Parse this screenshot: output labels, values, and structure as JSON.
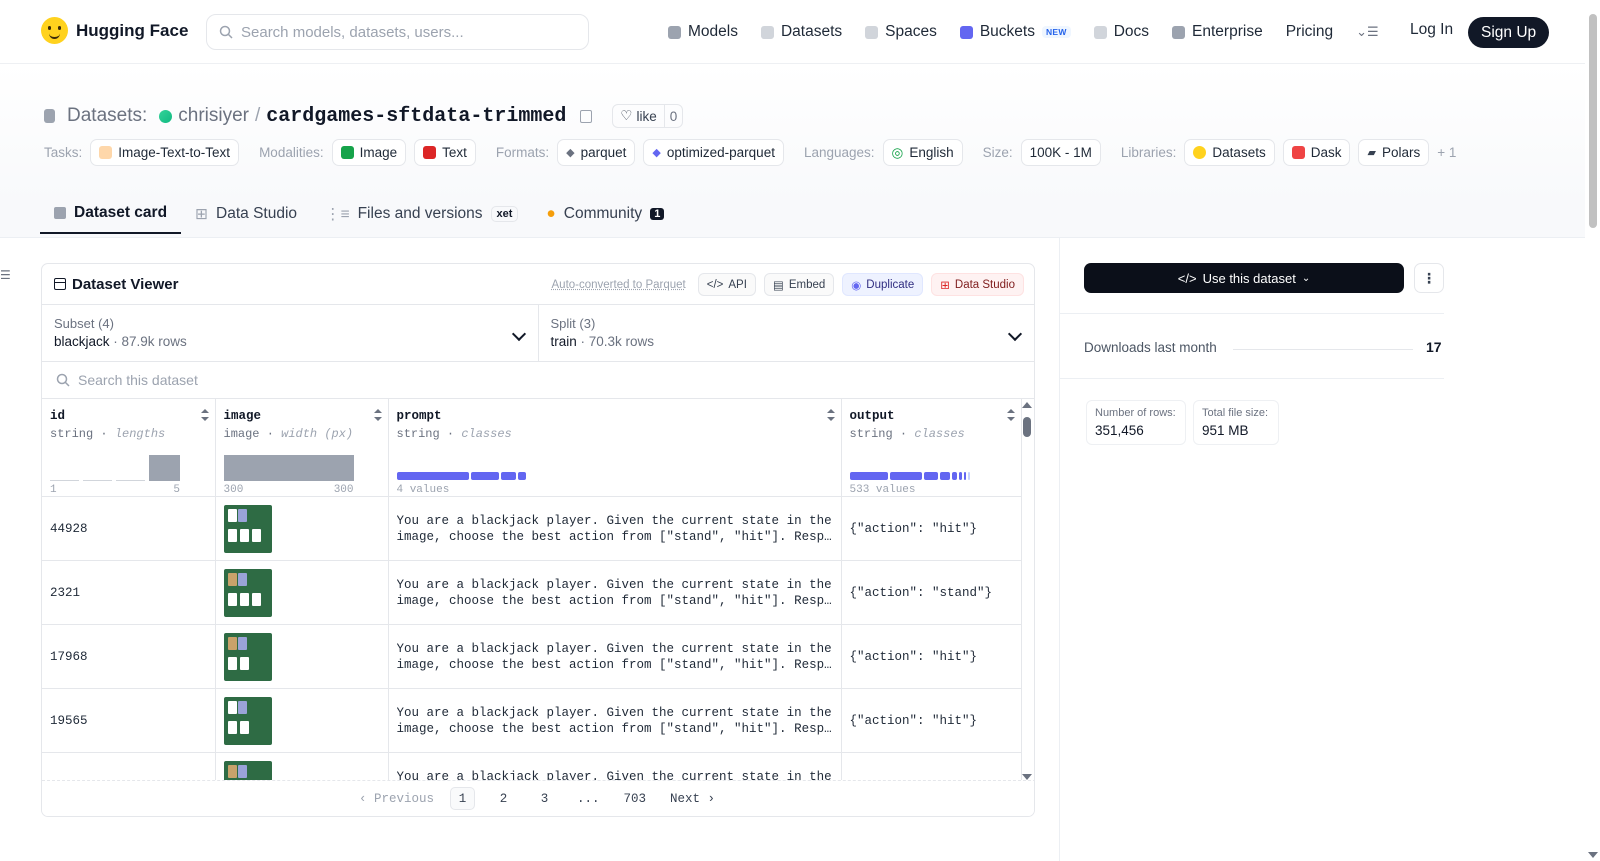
{
  "header": {
    "brand": "Hugging Face",
    "search_placeholder": "Search models, datasets, users...",
    "nav": [
      {
        "label": "Models",
        "icon": "models-icon",
        "color": "#9ca3af"
      },
      {
        "label": "Datasets",
        "icon": "datasets-icon",
        "color": "#d1d5db"
      },
      {
        "label": "Spaces",
        "icon": "spaces-icon",
        "color": "#d1d5db"
      },
      {
        "label": "Buckets",
        "icon": "buckets-icon",
        "color": "#6366f1",
        "badge": "NEW"
      },
      {
        "label": "Docs",
        "icon": "docs-icon",
        "color": "#d1d5db"
      },
      {
        "label": "Enterprise",
        "icon": "enterprise-icon",
        "color": "#9ca3af"
      },
      {
        "label": "Pricing"
      }
    ],
    "login": "Log In",
    "signup": "Sign Up"
  },
  "dataset": {
    "section_label": "Datasets:",
    "owner": "chrisiyer",
    "name": "cardgames-sftdata-trimmed",
    "like_label": "like",
    "like_count": "0"
  },
  "tags": {
    "tasks_label": "Tasks:",
    "tasks": [
      "Image-Text-to-Text"
    ],
    "modalities_label": "Modalities:",
    "modalities": [
      "Image",
      "Text"
    ],
    "formats_label": "Formats:",
    "formats": [
      "parquet",
      "optimized-parquet"
    ],
    "languages_label": "Languages:",
    "languages": [
      "English"
    ],
    "size_label": "Size:",
    "size": "100K - 1M",
    "libraries_label": "Libraries:",
    "libraries": [
      "Datasets",
      "Dask",
      "Polars"
    ],
    "more": "+ 1"
  },
  "tabs": {
    "card": "Dataset card",
    "studio": "Data Studio",
    "files": "Files and versions",
    "xet": "xet",
    "community": "Community",
    "community_count": "1"
  },
  "viewer": {
    "title": "Dataset Viewer",
    "auto_converted": "Auto-converted to Parquet",
    "api": "API",
    "embed": "Embed",
    "duplicate": "Duplicate",
    "data_studio": "Data Studio",
    "subset_label": "Subset (4)",
    "subset_value": "blackjack",
    "subset_rows": "87.9k rows",
    "split_label": "Split (3)",
    "split_value": "train",
    "split_rows": "70.3k rows",
    "search_placeholder": "Search this dataset",
    "columns": [
      {
        "name": "id",
        "type": "string",
        "stat": "lengths",
        "min": "1",
        "max": "5"
      },
      {
        "name": "image",
        "type": "image",
        "stat": "width (px)",
        "min": "300",
        "max": "300"
      },
      {
        "name": "prompt",
        "type": "string",
        "stat": "classes",
        "note": "4 values"
      },
      {
        "name": "output",
        "type": "string",
        "stat": "classes",
        "note": "533 values"
      }
    ],
    "rows": [
      {
        "id": "44928",
        "prompt1": "You are a blackjack player. Given the current state in the",
        "prompt2": "image, choose the best action from [\"stand\", \"hit\"]. Respon…",
        "output": "{\"action\": \"hit\"}"
      },
      {
        "id": "2321",
        "prompt1": "You are a blackjack player. Given the current state in the",
        "prompt2": "image, choose the best action from [\"stand\", \"hit\"]. Respon…",
        "output": "{\"action\": \"stand\"}"
      },
      {
        "id": "17968",
        "prompt1": "You are a blackjack player. Given the current state in the",
        "prompt2": "image, choose the best action from [\"stand\", \"hit\"]. Respon…",
        "output": "{\"action\": \"hit\"}"
      },
      {
        "id": "19565",
        "prompt1": "You are a blackjack player. Given the current state in the",
        "prompt2": "image, choose the best action from [\"stand\", \"hit\"]. Respon…",
        "output": "{\"action\": \"hit\"}"
      },
      {
        "id": "",
        "prompt1": "You are a blackjack player. Given the current state in the",
        "prompt2": "",
        "output": ""
      }
    ],
    "pagination": {
      "prev": "Previous",
      "pages": [
        "1",
        "2",
        "3",
        "...",
        "703"
      ],
      "next": "Next"
    }
  },
  "sidebar": {
    "use_button": "Use this dataset",
    "downloads_label": "Downloads last month",
    "downloads_value": "17",
    "rows_label": "Number of rows:",
    "rows_value": "351,456",
    "size_label": "Total file size:",
    "size_value": "951 MB"
  }
}
